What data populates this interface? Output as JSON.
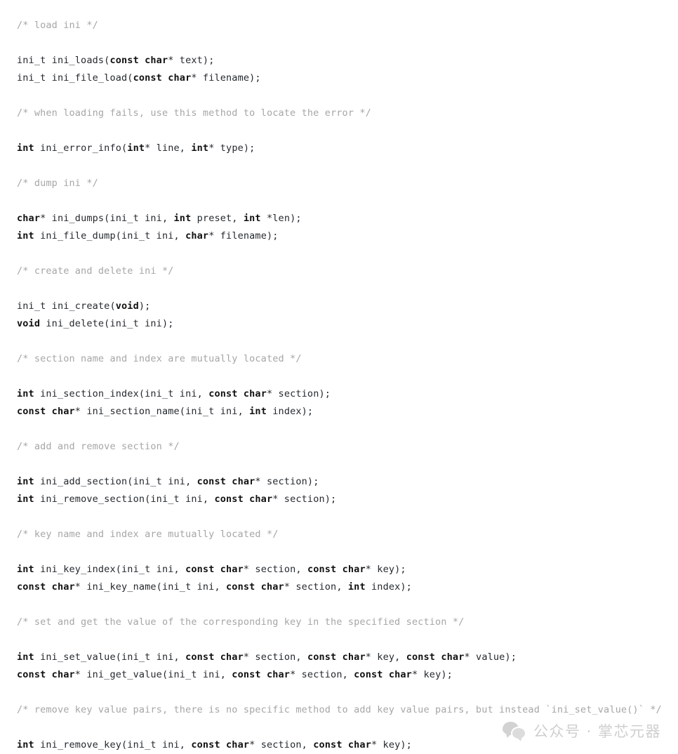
{
  "page": {
    "background_color": "#ffffff",
    "language": "c",
    "comment_color": "#a6a6a6",
    "keyword_color": "#111111",
    "text_color": "#24292e"
  },
  "code": {
    "lines": [
      {
        "type": "comment",
        "tokens": [
          {
            "t": "comment",
            "s": "/* load ini */"
          }
        ]
      },
      {
        "type": "blank",
        "tokens": []
      },
      {
        "type": "code",
        "tokens": [
          {
            "t": "plain",
            "s": "ini_t ini_loads("
          },
          {
            "t": "keyword",
            "s": "const"
          },
          {
            "t": "plain",
            "s": " "
          },
          {
            "t": "keyword",
            "s": "char"
          },
          {
            "t": "plain",
            "s": "* text);"
          }
        ]
      },
      {
        "type": "code",
        "tokens": [
          {
            "t": "plain",
            "s": "ini_t ini_file_load("
          },
          {
            "t": "keyword",
            "s": "const"
          },
          {
            "t": "plain",
            "s": " "
          },
          {
            "t": "keyword",
            "s": "char"
          },
          {
            "t": "plain",
            "s": "* filename);"
          }
        ]
      },
      {
        "type": "blank",
        "tokens": []
      },
      {
        "type": "comment",
        "tokens": [
          {
            "t": "comment",
            "s": "/* when loading fails, use this method to locate the error */"
          }
        ]
      },
      {
        "type": "blank",
        "tokens": []
      },
      {
        "type": "code",
        "tokens": [
          {
            "t": "keyword",
            "s": "int"
          },
          {
            "t": "plain",
            "s": " ini_error_info("
          },
          {
            "t": "keyword",
            "s": "int"
          },
          {
            "t": "plain",
            "s": "* line, "
          },
          {
            "t": "keyword",
            "s": "int"
          },
          {
            "t": "plain",
            "s": "* type);"
          }
        ]
      },
      {
        "type": "blank",
        "tokens": []
      },
      {
        "type": "comment",
        "tokens": [
          {
            "t": "comment",
            "s": "/* dump ini */"
          }
        ]
      },
      {
        "type": "blank",
        "tokens": []
      },
      {
        "type": "code",
        "tokens": [
          {
            "t": "keyword",
            "s": "char"
          },
          {
            "t": "plain",
            "s": "* ini_dumps(ini_t ini, "
          },
          {
            "t": "keyword",
            "s": "int"
          },
          {
            "t": "plain",
            "s": " preset, "
          },
          {
            "t": "keyword",
            "s": "int"
          },
          {
            "t": "plain",
            "s": " *len);"
          }
        ]
      },
      {
        "type": "code",
        "tokens": [
          {
            "t": "keyword",
            "s": "int"
          },
          {
            "t": "plain",
            "s": " ini_file_dump(ini_t ini, "
          },
          {
            "t": "keyword",
            "s": "char"
          },
          {
            "t": "plain",
            "s": "* filename);"
          }
        ]
      },
      {
        "type": "blank",
        "tokens": []
      },
      {
        "type": "comment",
        "tokens": [
          {
            "t": "comment",
            "s": "/* create and delete ini */"
          }
        ]
      },
      {
        "type": "blank",
        "tokens": []
      },
      {
        "type": "code",
        "tokens": [
          {
            "t": "plain",
            "s": "ini_t ini_create("
          },
          {
            "t": "keyword",
            "s": "void"
          },
          {
            "t": "plain",
            "s": ");"
          }
        ]
      },
      {
        "type": "code",
        "tokens": [
          {
            "t": "keyword",
            "s": "void"
          },
          {
            "t": "plain",
            "s": " ini_delete(ini_t ini);"
          }
        ]
      },
      {
        "type": "blank",
        "tokens": []
      },
      {
        "type": "comment",
        "tokens": [
          {
            "t": "comment",
            "s": "/* section name and index are mutually located */"
          }
        ]
      },
      {
        "type": "blank",
        "tokens": []
      },
      {
        "type": "code",
        "tokens": [
          {
            "t": "keyword",
            "s": "int"
          },
          {
            "t": "plain",
            "s": " ini_section_index(ini_t ini, "
          },
          {
            "t": "keyword",
            "s": "const"
          },
          {
            "t": "plain",
            "s": " "
          },
          {
            "t": "keyword",
            "s": "char"
          },
          {
            "t": "plain",
            "s": "* section);"
          }
        ]
      },
      {
        "type": "code",
        "tokens": [
          {
            "t": "keyword",
            "s": "const"
          },
          {
            "t": "plain",
            "s": " "
          },
          {
            "t": "keyword",
            "s": "char"
          },
          {
            "t": "plain",
            "s": "* ini_section_name(ini_t ini, "
          },
          {
            "t": "keyword",
            "s": "int"
          },
          {
            "t": "plain",
            "s": " index);"
          }
        ]
      },
      {
        "type": "blank",
        "tokens": []
      },
      {
        "type": "comment",
        "tokens": [
          {
            "t": "comment",
            "s": "/* add and remove section */"
          }
        ]
      },
      {
        "type": "blank",
        "tokens": []
      },
      {
        "type": "code",
        "tokens": [
          {
            "t": "keyword",
            "s": "int"
          },
          {
            "t": "plain",
            "s": " ini_add_section(ini_t ini, "
          },
          {
            "t": "keyword",
            "s": "const"
          },
          {
            "t": "plain",
            "s": " "
          },
          {
            "t": "keyword",
            "s": "char"
          },
          {
            "t": "plain",
            "s": "* section);"
          }
        ]
      },
      {
        "type": "code",
        "tokens": [
          {
            "t": "keyword",
            "s": "int"
          },
          {
            "t": "plain",
            "s": " ini_remove_section(ini_t ini, "
          },
          {
            "t": "keyword",
            "s": "const"
          },
          {
            "t": "plain",
            "s": " "
          },
          {
            "t": "keyword",
            "s": "char"
          },
          {
            "t": "plain",
            "s": "* section);"
          }
        ]
      },
      {
        "type": "blank",
        "tokens": []
      },
      {
        "type": "comment",
        "tokens": [
          {
            "t": "comment",
            "s": "/* key name and index are mutually located */"
          }
        ]
      },
      {
        "type": "blank",
        "tokens": []
      },
      {
        "type": "code",
        "tokens": [
          {
            "t": "keyword",
            "s": "int"
          },
          {
            "t": "plain",
            "s": " ini_key_index(ini_t ini, "
          },
          {
            "t": "keyword",
            "s": "const"
          },
          {
            "t": "plain",
            "s": " "
          },
          {
            "t": "keyword",
            "s": "char"
          },
          {
            "t": "plain",
            "s": "* section, "
          },
          {
            "t": "keyword",
            "s": "const"
          },
          {
            "t": "plain",
            "s": " "
          },
          {
            "t": "keyword",
            "s": "char"
          },
          {
            "t": "plain",
            "s": "* key);"
          }
        ]
      },
      {
        "type": "code",
        "tokens": [
          {
            "t": "keyword",
            "s": "const"
          },
          {
            "t": "plain",
            "s": " "
          },
          {
            "t": "keyword",
            "s": "char"
          },
          {
            "t": "plain",
            "s": "* ini_key_name(ini_t ini, "
          },
          {
            "t": "keyword",
            "s": "const"
          },
          {
            "t": "plain",
            "s": " "
          },
          {
            "t": "keyword",
            "s": "char"
          },
          {
            "t": "plain",
            "s": "* section, "
          },
          {
            "t": "keyword",
            "s": "int"
          },
          {
            "t": "plain",
            "s": " index);"
          }
        ]
      },
      {
        "type": "blank",
        "tokens": []
      },
      {
        "type": "comment",
        "tokens": [
          {
            "t": "comment",
            "s": "/* set and get the value of the corresponding key in the specified section */"
          }
        ]
      },
      {
        "type": "blank",
        "tokens": []
      },
      {
        "type": "code",
        "tokens": [
          {
            "t": "keyword",
            "s": "int"
          },
          {
            "t": "plain",
            "s": " ini_set_value(ini_t ini, "
          },
          {
            "t": "keyword",
            "s": "const"
          },
          {
            "t": "plain",
            "s": " "
          },
          {
            "t": "keyword",
            "s": "char"
          },
          {
            "t": "plain",
            "s": "* section, "
          },
          {
            "t": "keyword",
            "s": "const"
          },
          {
            "t": "plain",
            "s": " "
          },
          {
            "t": "keyword",
            "s": "char"
          },
          {
            "t": "plain",
            "s": "* key, "
          },
          {
            "t": "keyword",
            "s": "const"
          },
          {
            "t": "plain",
            "s": " "
          },
          {
            "t": "keyword",
            "s": "char"
          },
          {
            "t": "plain",
            "s": "* value);"
          }
        ]
      },
      {
        "type": "code",
        "tokens": [
          {
            "t": "keyword",
            "s": "const"
          },
          {
            "t": "plain",
            "s": " "
          },
          {
            "t": "keyword",
            "s": "char"
          },
          {
            "t": "plain",
            "s": "* ini_get_value(ini_t ini, "
          },
          {
            "t": "keyword",
            "s": "const"
          },
          {
            "t": "plain",
            "s": " "
          },
          {
            "t": "keyword",
            "s": "char"
          },
          {
            "t": "plain",
            "s": "* section, "
          },
          {
            "t": "keyword",
            "s": "const"
          },
          {
            "t": "plain",
            "s": " "
          },
          {
            "t": "keyword",
            "s": "char"
          },
          {
            "t": "plain",
            "s": "* key);"
          }
        ]
      },
      {
        "type": "blank",
        "tokens": []
      },
      {
        "type": "comment",
        "tokens": [
          {
            "t": "comment",
            "s": "/* remove key value pairs, there is no specific method to add key value pairs, but instead `ini_set_value()` */"
          }
        ]
      },
      {
        "type": "blank",
        "tokens": []
      },
      {
        "type": "code",
        "tokens": [
          {
            "t": "keyword",
            "s": "int"
          },
          {
            "t": "plain",
            "s": " ini_remove_key(ini_t ini, "
          },
          {
            "t": "keyword",
            "s": "const"
          },
          {
            "t": "plain",
            "s": " "
          },
          {
            "t": "keyword",
            "s": "char"
          },
          {
            "t": "plain",
            "s": "* section, "
          },
          {
            "t": "keyword",
            "s": "const"
          },
          {
            "t": "plain",
            "s": " "
          },
          {
            "t": "keyword",
            "s": "char"
          },
          {
            "t": "plain",
            "s": "* key);"
          }
        ]
      }
    ]
  },
  "watermark": {
    "logo_icon": "wechat-logo-icon",
    "text": "公众号 · 掌芯元器",
    "color": "#cfcfcf"
  }
}
